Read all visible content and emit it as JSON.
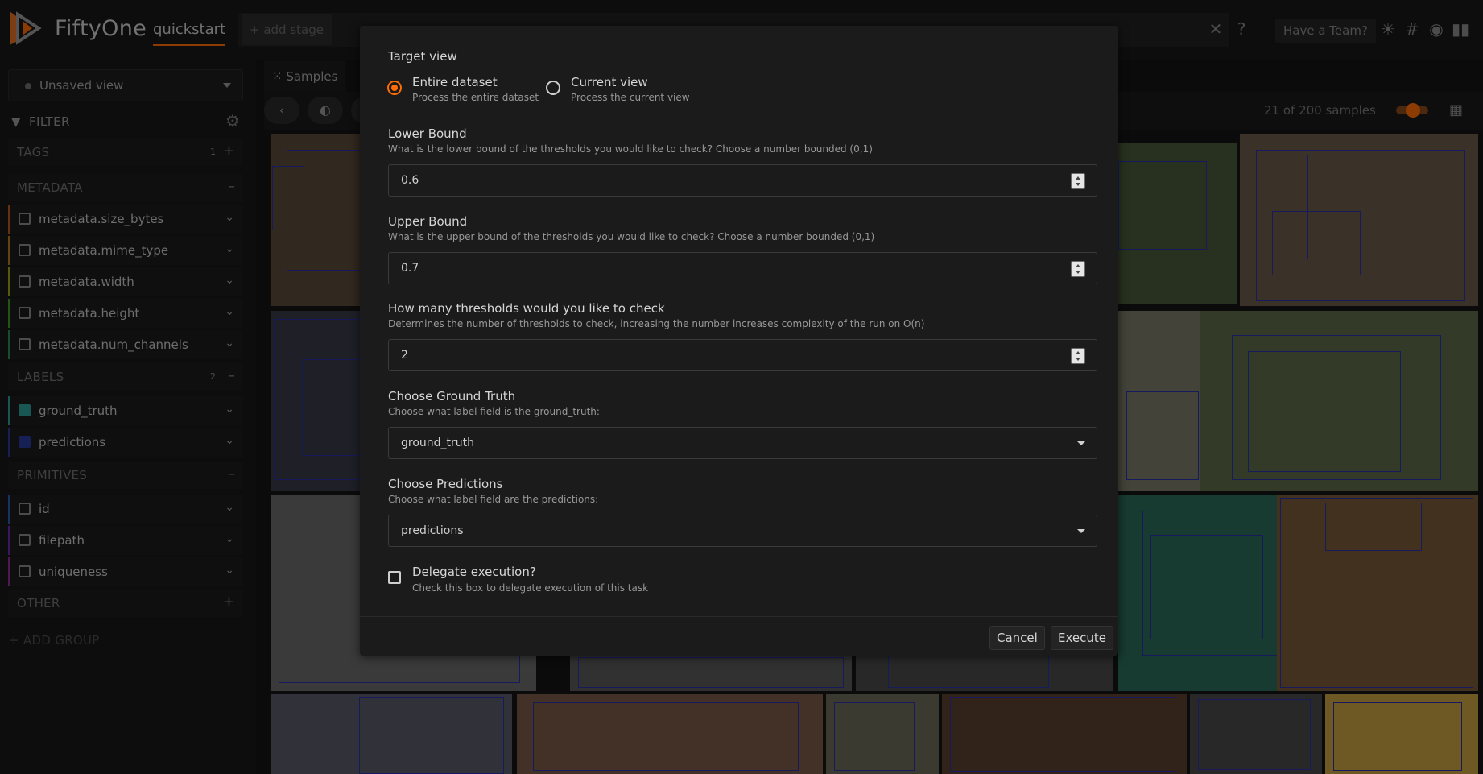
{
  "header": {
    "brand": "FiftyOne",
    "dataset": "quickstart",
    "add_stage": "+ add stage",
    "team_button": "Have a Team?"
  },
  "sidebar": {
    "view_label": "Unsaved view",
    "filter_label": "FILTER",
    "groups": {
      "tags": {
        "label": "TAGS",
        "count": "1"
      },
      "metadata": {
        "label": "METADATA"
      },
      "labels": {
        "label": "LABELS",
        "count": "2"
      },
      "primitives": {
        "label": "PRIMITIVES"
      },
      "other": {
        "label": "OTHER"
      }
    },
    "metadata_fields": [
      "metadata.size_bytes",
      "metadata.mime_type",
      "metadata.width",
      "metadata.height",
      "metadata.num_channels"
    ],
    "label_fields": [
      "ground_truth",
      "predictions"
    ],
    "primitive_fields": [
      "id",
      "filepath",
      "uniqueness"
    ],
    "add_group": "+ ADD GROUP"
  },
  "content": {
    "tab_samples": "Samples",
    "sample_count": "21 of 200 samples"
  },
  "modal": {
    "target_view": {
      "label": "Target view",
      "options": [
        {
          "label": "Entire dataset",
          "desc": "Process the entire dataset",
          "selected": true
        },
        {
          "label": "Current view",
          "desc": "Process the current view",
          "selected": false
        }
      ]
    },
    "lower_bound": {
      "label": "Lower Bound",
      "desc": "What is the lower bound of the thresholds you would like to check? Choose a number bounded (0,1)",
      "value": "0.6"
    },
    "upper_bound": {
      "label": "Upper Bound",
      "desc": "What is the upper bound of the thresholds you would like to check? Choose a number bounded (0,1)",
      "value": "0.7"
    },
    "num_thresholds": {
      "label": "How many thresholds would you like to check",
      "desc": "Determines the number of thresholds to check, increasing the number increases complexity of the run on O(n)",
      "value": "2"
    },
    "ground_truth": {
      "label": "Choose Ground Truth",
      "desc": "Choose what label field is the ground_truth:",
      "value": "ground_truth"
    },
    "predictions": {
      "label": "Choose Predictions",
      "desc": "Choose what label field are the predictions:",
      "value": "predictions"
    },
    "delegate": {
      "label": "Delegate execution?",
      "desc": "Check this box to delegate execution of this task",
      "checked": false
    },
    "cancel": "Cancel",
    "execute": "Execute"
  },
  "colors": {
    "accent": "#ff6d04",
    "bbox": "#2b30a8"
  }
}
